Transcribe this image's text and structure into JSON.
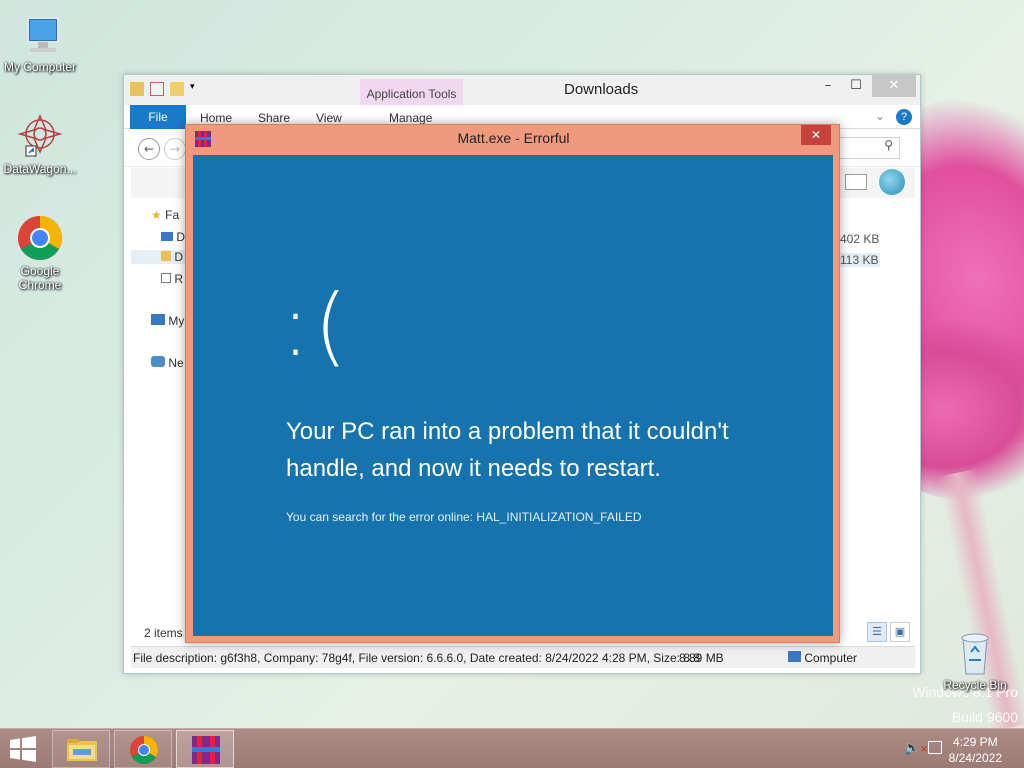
{
  "desktop": {
    "icons": [
      {
        "label": "My Computer"
      },
      {
        "label": "DataWagon..."
      },
      {
        "label": "Google Chrome"
      },
      {
        "label": "Recycle Bin"
      }
    ],
    "watermark_line1": "Windows 8.1 Pro",
    "watermark_line2": "Build 9600"
  },
  "explorer": {
    "title": "Downloads",
    "context_tab": "Application Tools",
    "tabs": {
      "file": "File",
      "home": "Home",
      "share": "Share",
      "view": "View",
      "manage": "Manage"
    },
    "nav": [
      {
        "label": "Favorites"
      },
      {
        "label": "Desktop"
      },
      {
        "label": "Downloads"
      },
      {
        "label": "Recent places"
      },
      {
        "label": "My Computer"
      },
      {
        "label": "Network"
      }
    ],
    "nav_truncated": [
      "Fa",
      "D",
      "D",
      "R",
      "My",
      "Ne"
    ],
    "file_sizes": [
      "402 KB",
      "113 KB"
    ],
    "items_count": "2 items",
    "status": {
      "description": "File description: g6f3h8, Company: 78g4f, File version: 6.6.6.0, Date created: 8/24/2022 4:28 PM, Size: 8.8",
      "size": "8.89 MB",
      "location": "Computer"
    }
  },
  "dialog": {
    "title": "Matt.exe - Errorful",
    "sad_face": ":(",
    "message": "Your PC ran into a problem that it couldn't handle, and now it needs to restart.",
    "sub_message": "You can search for the error online: HAL_INITIALIZATION_FAILED"
  },
  "taskbar": {
    "time": "4:29 PM",
    "date": "8/24/2022",
    "buttons": [
      "start-icon",
      "file-explorer-icon",
      "chrome-icon",
      "matt-exe-icon"
    ]
  },
  "colors": {
    "bsod_blue": "#1673ad",
    "dialog_frame": "#ef9a7d",
    "ribbon_file": "#1979ca",
    "context_tab": "#f1d8f0"
  }
}
